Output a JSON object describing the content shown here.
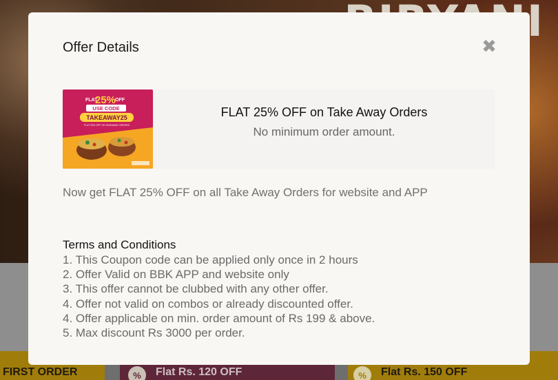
{
  "background": {
    "hero_text": "BIRYANI",
    "coupons": [
      {
        "label": "FIRST ORDER"
      },
      {
        "label": "Flat Rs. 120 OFF",
        "icon": "percent-icon"
      },
      {
        "label": "Flat Rs. 150 OFF",
        "icon": "percent-icon"
      }
    ]
  },
  "modal": {
    "title": "Offer Details",
    "close_icon": "close-icon",
    "offer": {
      "heading": "FLAT 25% OFF on Take Away Orders",
      "subheading": "No minimum order amount.",
      "banner": {
        "flat": "FLAT",
        "percent": "25%",
        "off": "OFF",
        "use_code": "USE CODE",
        "code": "TAKEAWAY25",
        "small": "FLAT 25% OFF ON TAKEAWAY ORDERS"
      }
    },
    "description": "Now get FLAT 25% OFF on all Take Away Orders for website and APP",
    "terms_title": "Terms and Conditions",
    "terms": [
      "1. This Coupon code can be applied only once in 2 hours",
      "2. Offer Valid on BBK APP and website only",
      "3. This offer cannot be clubbed with any other offer.",
      "4. Offer not valid on combos or already discounted offer.",
      "4. Offer applicable on min. order amount of Rs 199 & above.",
      "5. Max discount Rs 3000 per order."
    ]
  },
  "colors": {
    "modal_bg": "#f8f7f3",
    "banner_magenta": "#c81e5a",
    "banner_orange": "#f5a623"
  }
}
